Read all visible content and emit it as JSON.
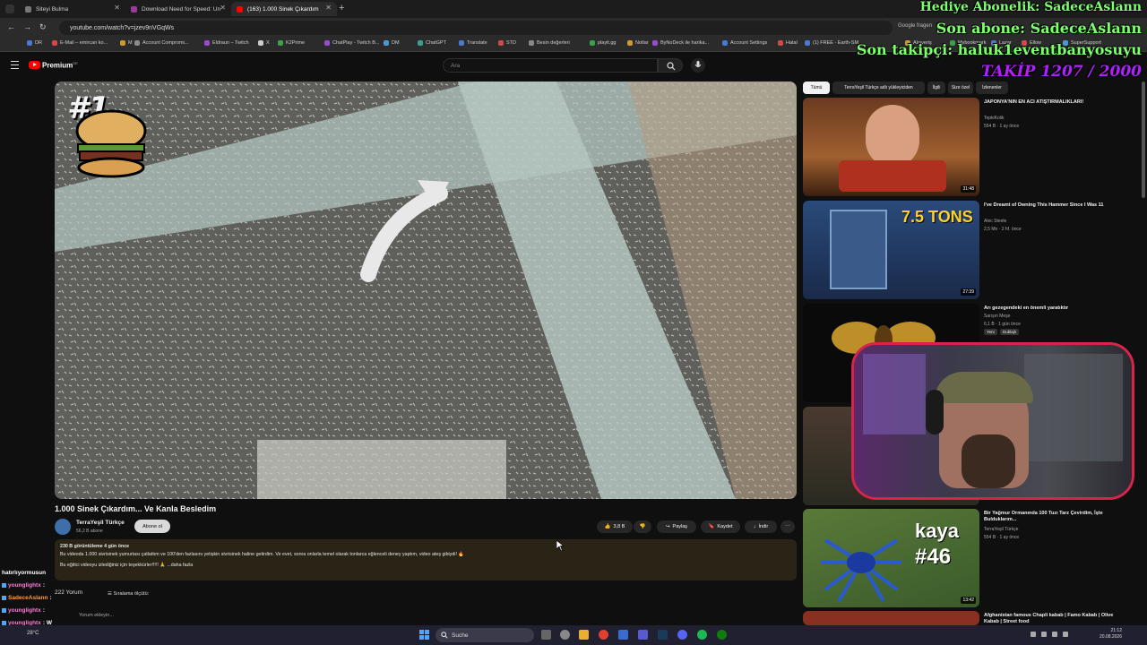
{
  "browser": {
    "tabs": [
      {
        "title": "Siteyi Bulma",
        "active": false
      },
      {
        "title": "Download Need for Speed: Un",
        "active": false
      },
      {
        "title": "(163) 1.000 Sinek Çıkardım",
        "active": true
      }
    ],
    "url": "youtube.com/watch?v=jzev9nVGqWs",
    "google_fragment": "Google fragen",
    "bookmarks": [
      "DR",
      "E-Mail – emircan ko...",
      "M",
      "Account Compromi...",
      "Eldraun – Twitch",
      "X",
      "K2Prime",
      "ChatPlay - Twitch B...",
      "DM",
      "ChatGPT",
      "Translate",
      "STD",
      "Besin değerleri",
      "playit.gg",
      "Notlar",
      "ByNoDeck ile harika...",
      "Account Settings",
      "Hatal",
      "(1) FREE - Earth-SM...",
      "Alışveriş",
      "Mybookmark",
      "Lazar",
      "Ellow",
      "SuperSupport"
    ]
  },
  "youtube": {
    "brand": "Premium",
    "brand_sup": "DE",
    "search_placeholder": "Ara",
    "video": {
      "title": "1.000 Sinek Çıkardım... Ve Kanla Besledim",
      "channel": "TerraYeşil Türkçe",
      "subscribers": "56,2 B abone",
      "subscribe_label": "Abone ol",
      "likes": "3,8 B",
      "share": "Paylaş",
      "save": "Kaydet",
      "download": "İndir",
      "overlay_rank": "#1",
      "description": {
        "meta": "230 B görüntüleme  4 gün önce",
        "line1": "Bu videoda 1.000 sivrisinek yumurtası çatlattım ve 100'den fazlasını yetişkin sivrisinek haline getirdim. Ve evet, sonra onlarla temel olarak tonlarca eğlenceli deney yaptım, video ateş gibiydi! 🔥",
        "line2": "Bu eğitici videoyu izlediğiniz için teşekkürler!!!!! 🙏 ...daha fazla"
      },
      "comments_count": "222 Yorum",
      "sort_label": "Sıralama ölçütü:",
      "add_comment": "Yorum ekleyin..."
    },
    "chips": [
      "Tümü",
      "TerraYeşil Türkçe adlı yükleyiciden",
      "İlgili",
      "Size özel",
      "İzlenenler"
    ],
    "recommended": [
      {
        "title": "JAPONYA'NIN EN ACI ATIŞTIRMALIKLARI!",
        "channel": "TepkiKolik",
        "meta": "554 B · 1 ay önce",
        "duration": "31:48"
      },
      {
        "title": "I've Dreamt of Owning This Hammer Since I Was 11",
        "channel": "Alec Steele",
        "meta": "2,5 Mn · 2 hf. önce",
        "duration": "27:39",
        "thumb_text": "7.5 TONS"
      },
      {
        "title": "Arı gezegendeki en önemli yaratıktır",
        "channel": "Sarışın Meşe",
        "meta": "6,1 B · 1 gün önce",
        "badges": [
          "Yeni",
          "Dublajlı"
        ]
      },
      {
        "title": "Bir Yağmur Ormanında 100 Tuzı Tarz Çevirdim, İşte Bulduklarım...",
        "channel": "TerraYeşil Türkçe",
        "meta": "554 B · 1 ay önce",
        "duration": "13:42",
        "thumb_text_1": "kaya",
        "thumb_text_2": "#46"
      },
      {
        "title": "Afghanistan famous Chapli kabab | Famo Kabab | Olive Kabab | Street food"
      }
    ]
  },
  "stream_overlay": {
    "hediye": "Hediye Abonelik: SadeceAslann",
    "son_abone": "Son abone: SadeceAslann",
    "son_takipci": "Son takipçi: haluk1eventbanyosuyu",
    "takip": "TAKİP 1207 / 2000"
  },
  "chat": [
    {
      "user": "",
      "text": "hatırlıyormusun",
      "color": "#ffffff"
    },
    {
      "user": "younglightx",
      "text": ":",
      "color": "#ff7bd9"
    },
    {
      "user": "SadeceAslann",
      "text": ":",
      "color": "#ff9b3d"
    },
    {
      "user": "younglightx",
      "text": ":",
      "color": "#ff7bd9"
    },
    {
      "user": "younglightx",
      "text": ": W",
      "color": "#ff7bd9"
    },
    {
      "user": "K2Prime",
      "text": ":",
      "color": "#b37bff"
    }
  ],
  "taskbar": {
    "search": "Suche",
    "weather": "28°C",
    "time": "21:12",
    "date": "20.08.2026"
  }
}
